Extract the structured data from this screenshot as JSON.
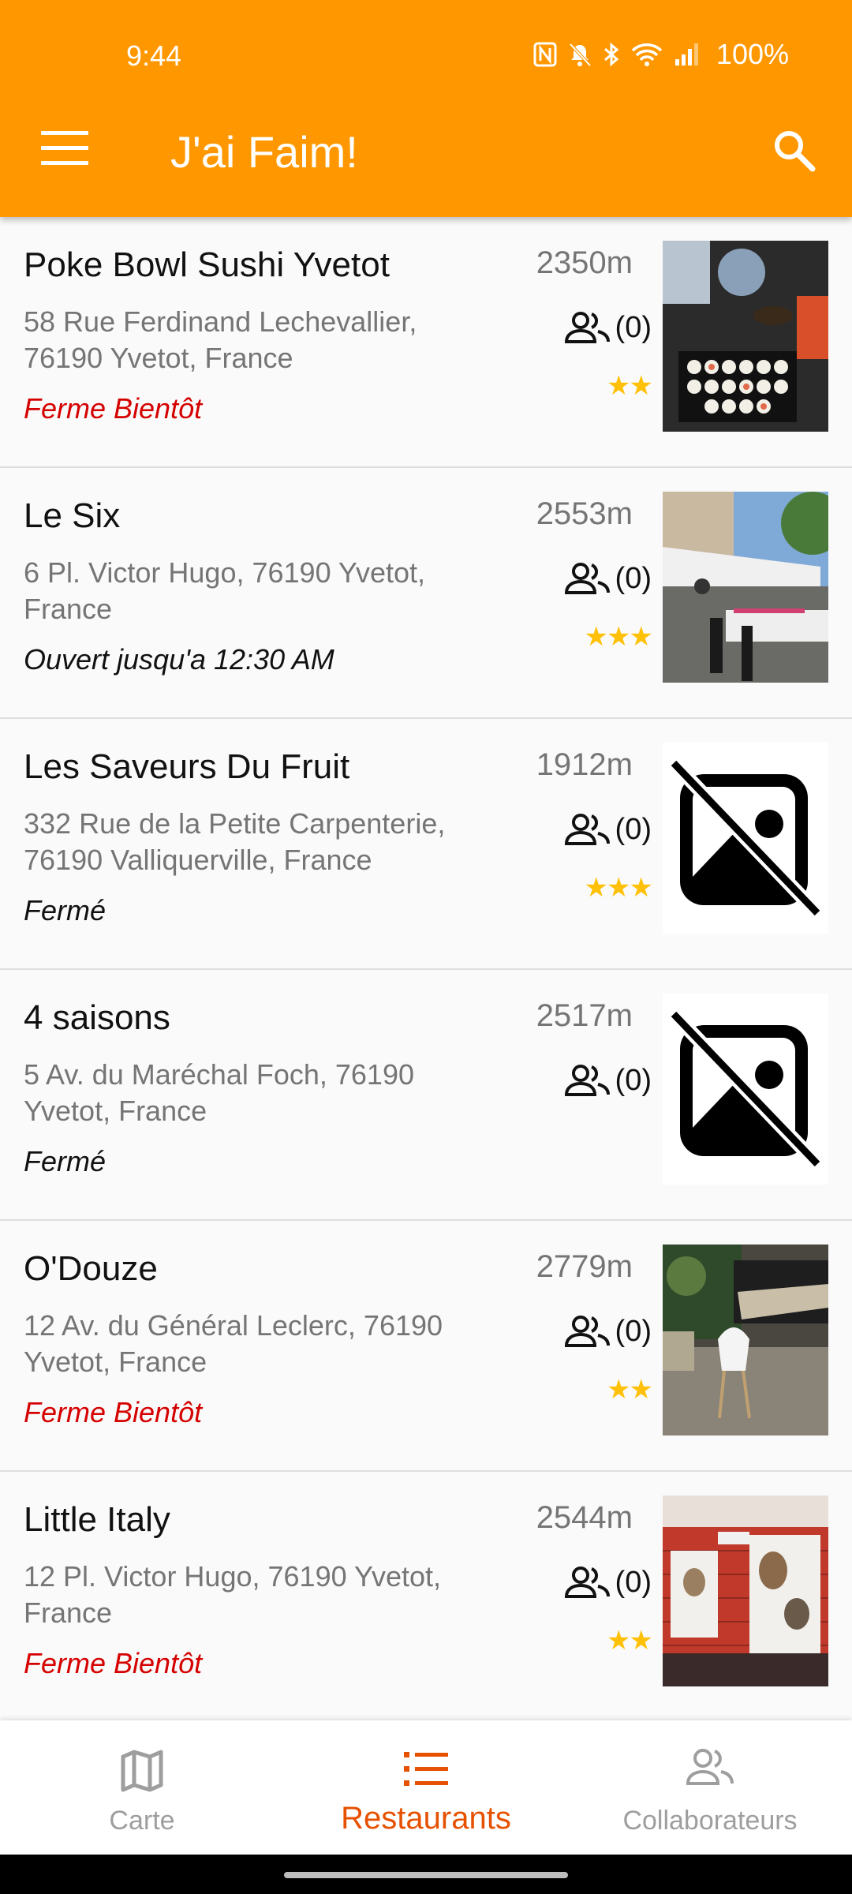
{
  "status_bar": {
    "time": "9:44",
    "battery": "100%"
  },
  "app": {
    "title": "J'ai Faim!"
  },
  "restaurants": [
    {
      "name": "Poke Bowl Sushi Yvetot",
      "address": "58 Rue Ferdinand Lechevallier, 76190 Yvetot, France",
      "status": "Ferme Bientôt",
      "distance": "2350m",
      "workmates": "(0)",
      "stars": "★★",
      "image": "photo-sushi"
    },
    {
      "name": "Le Six",
      "address": "6 Pl. Victor Hugo, 76190 Yvetot, France",
      "status": "Ouvert jusqu'a 12:30 AM",
      "distance": "2553m",
      "workmates": "(0)",
      "stars": "★★★",
      "image": "photo-terrace"
    },
    {
      "name": "Les Saveurs Du Fruit",
      "address": "332 Rue de la Petite Carpenterie, 76190 Valliquerville, France",
      "status": "Fermé",
      "distance": "1912m",
      "workmates": "(0)",
      "stars": "★★★",
      "image": "no-image-icon"
    },
    {
      "name": "4 saisons",
      "address": "5 Av. du Maréchal Foch, 76190 Yvetot, France",
      "status": "Fermé",
      "distance": "2517m",
      "workmates": "(0)",
      "stars": "",
      "image": "no-image-icon"
    },
    {
      "name": "O'Douze",
      "address": "12 Av. du Général Leclerc, 76190 Yvetot, France",
      "status": "Ferme Bientôt",
      "distance": "2779m",
      "workmates": "(0)",
      "stars": "★★",
      "image": "photo-dining-room"
    },
    {
      "name": "Little Italy",
      "address": "12 Pl. Victor Hugo, 76190 Yvetot, France",
      "status": "Ferme Bientôt",
      "distance": "2544m",
      "workmates": "(0)",
      "stars": "★★",
      "image": "photo-brick-wall"
    }
  ],
  "bottom_nav": {
    "tabs": [
      {
        "label": "Carte",
        "icon": "map-icon",
        "active": false
      },
      {
        "label": "Restaurants",
        "icon": "list-icon",
        "active": true
      },
      {
        "label": "Collaborateurs",
        "icon": "people-icon",
        "active": false
      }
    ]
  },
  "colors": {
    "primary": "#FF9800",
    "accent": "#E65100",
    "closing": "#D50000",
    "star": "#FFC107"
  }
}
